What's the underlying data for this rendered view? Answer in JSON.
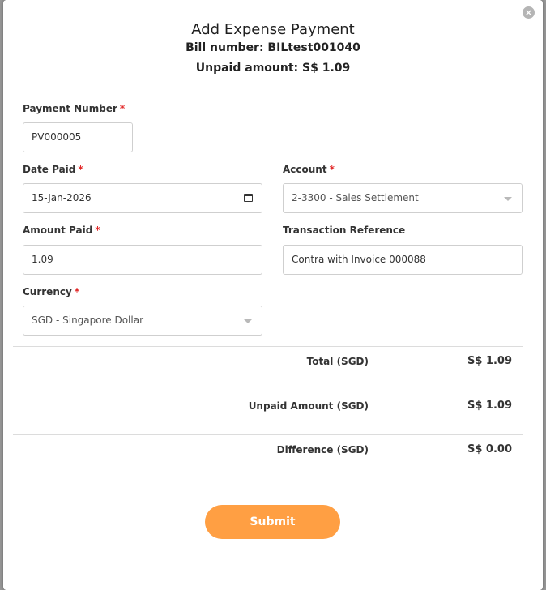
{
  "modal": {
    "title": "Add Expense Payment",
    "bill_number_text": "Bill number: BILtest001040",
    "unpaid_amount_text": "Unpaid amount: S$ 1.09",
    "close_glyph": "×"
  },
  "form": {
    "payment_number": {
      "label": "Payment Number",
      "required": "*",
      "value": "PV000005"
    },
    "date_paid": {
      "label": "Date Paid",
      "required": "*",
      "value": "15-Jan-2026"
    },
    "account": {
      "label": "Account",
      "required": "*",
      "value": "2-3300 - Sales Settlement"
    },
    "amount_paid": {
      "label": "Amount Paid",
      "required": "*",
      "value": "1.09"
    },
    "transaction_reference": {
      "label": "Transaction Reference",
      "value": "Contra with Invoice 000088"
    },
    "currency": {
      "label": "Currency",
      "required": "*",
      "value": "SGD - Singapore Dollar"
    }
  },
  "summary": {
    "total": {
      "label": "Total (SGD)",
      "value": "S$ 1.09"
    },
    "unpaid": {
      "label": "Unpaid Amount (SGD)",
      "value": "S$ 1.09"
    },
    "difference": {
      "label": "Difference (SGD)",
      "value": "S$ 0.00"
    }
  },
  "actions": {
    "submit_label": "Submit"
  },
  "colors": {
    "accent": "#ff9f43",
    "required": "#e22828",
    "backdrop": "#7d7d7d"
  }
}
